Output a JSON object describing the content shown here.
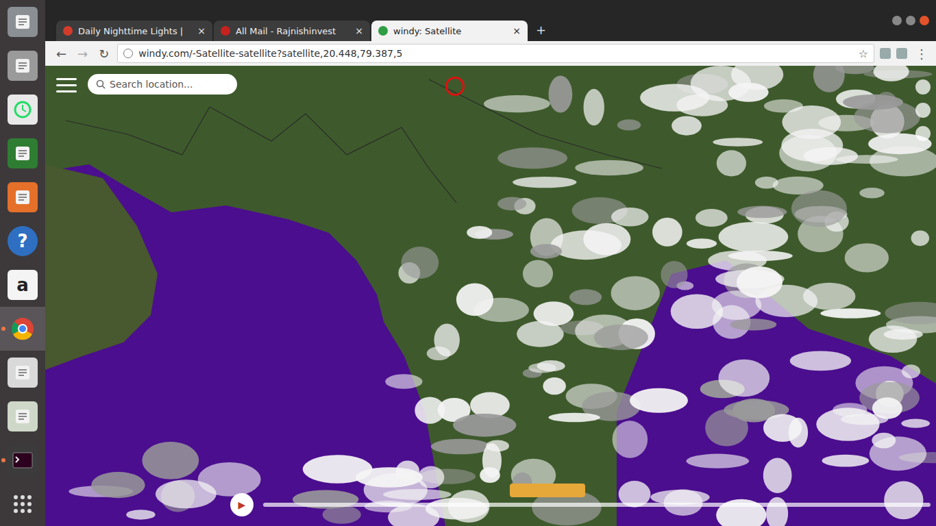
{
  "tabs": [
    {
      "label": "Daily Nighttime Lights |",
      "selected": false,
      "close": "×"
    },
    {
      "label": "All Mail - Rajnishinvest",
      "selected": false,
      "close": "×"
    },
    {
      "label": "windy: Satellite",
      "selected": true,
      "close": "×"
    }
  ],
  "new_tab": "+",
  "toolbar": {
    "back": "←",
    "forward": "→",
    "reload": "↻",
    "address": "windy.com/-Satellite-satellite?satellite,20.448,79.387,5",
    "star": "☆",
    "menu": "⋮"
  },
  "map": {
    "search_placeholder": "Search location...",
    "play": "▶"
  },
  "launcher": [
    {
      "kind": "drive",
      "running": false,
      "selected": false
    },
    {
      "kind": "disk",
      "running": false,
      "selected": false
    },
    {
      "kind": "clock",
      "running": false,
      "selected": false
    },
    {
      "kind": "document",
      "running": false,
      "selected": false
    },
    {
      "kind": "archive",
      "running": false,
      "selected": false
    },
    {
      "kind": "help",
      "glyph": "?",
      "running": false,
      "selected": false
    },
    {
      "kind": "store",
      "glyph": "a",
      "running": false,
      "selected": false
    },
    {
      "kind": "browser",
      "running": true,
      "selected": true
    },
    {
      "kind": "editor",
      "running": false,
      "selected": false
    },
    {
      "kind": "viewer",
      "running": false,
      "selected": false
    },
    {
      "kind": "terminal",
      "running": true,
      "selected": false
    },
    {
      "kind": "apps",
      "running": false,
      "selected": false
    }
  ]
}
